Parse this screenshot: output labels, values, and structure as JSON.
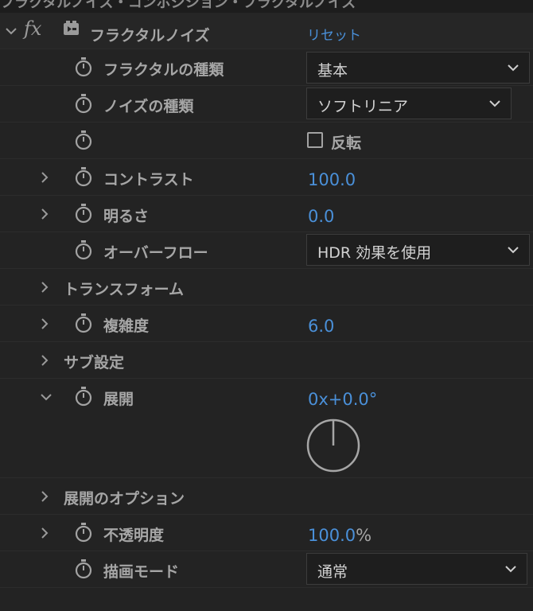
{
  "topbar": {
    "title": "フラクタルノイズ・コンポジション・フラクタルノイズ"
  },
  "effect": {
    "title": "フラクタルノイズ",
    "reset_label": "リセット",
    "fx_label": "fx"
  },
  "properties": {
    "fractal_type": {
      "label": "フラクタルの種類",
      "value": "基本"
    },
    "noise_type": {
      "label": "ノイズの種類",
      "value": "ソフトリニア"
    },
    "invert": {
      "label": "反転",
      "checked": false
    },
    "contrast": {
      "label": "コントラスト",
      "value": "100.0"
    },
    "brightness": {
      "label": "明るさ",
      "value": "0.0"
    },
    "overflow": {
      "label": "オーバーフロー",
      "value": "HDR 効果を使用"
    },
    "transform": {
      "label": "トランスフォーム"
    },
    "complexity": {
      "label": "複雑度",
      "value": "6.0"
    },
    "sub_settings": {
      "label": "サブ設定"
    },
    "evolution": {
      "label": "展開",
      "value": "0x+0.0°",
      "angle_degrees": 0
    },
    "evolution_options": {
      "label": "展開のオプション"
    },
    "opacity": {
      "label": "不透明度",
      "value_number": "100.0",
      "value_unit": "%"
    },
    "blend_mode": {
      "label": "描画モード",
      "value": "通常"
    }
  },
  "colors": {
    "accent": "#4a90d9",
    "panel_bg": "#232323",
    "dropdown_bg": "#1e1e1e"
  }
}
